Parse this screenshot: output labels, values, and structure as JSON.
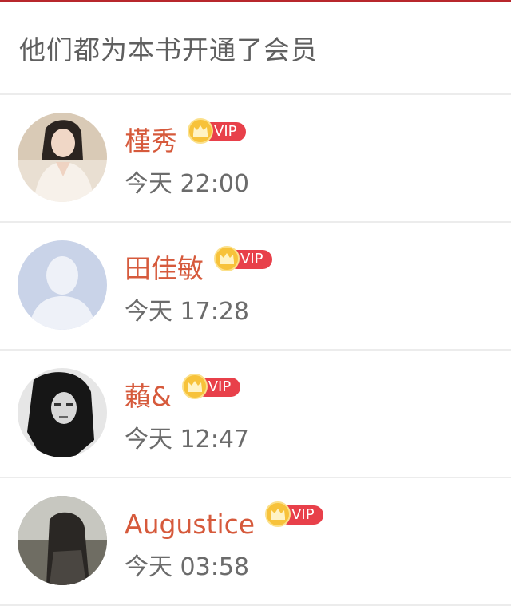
{
  "header": {
    "title": "他们都为本书开通了会员"
  },
  "badge": {
    "label": "VIP",
    "icon": "crown-icon",
    "color": "#e8404a"
  },
  "members": [
    {
      "name": "槿秀",
      "time": "今天 22:00",
      "avatar": "photo"
    },
    {
      "name": "田佳敏",
      "time": "今天 17:28",
      "avatar": "default-silhouette"
    },
    {
      "name": "藾&",
      "time": "今天 12:47",
      "avatar": "photo"
    },
    {
      "name": "Augustice",
      "time": "今天 03:58",
      "avatar": "photo"
    }
  ],
  "colors": {
    "name": "#d65a3c",
    "title": "#5f5f5f",
    "time": "#6b6b6b",
    "accent_strip": "#b8272c"
  }
}
